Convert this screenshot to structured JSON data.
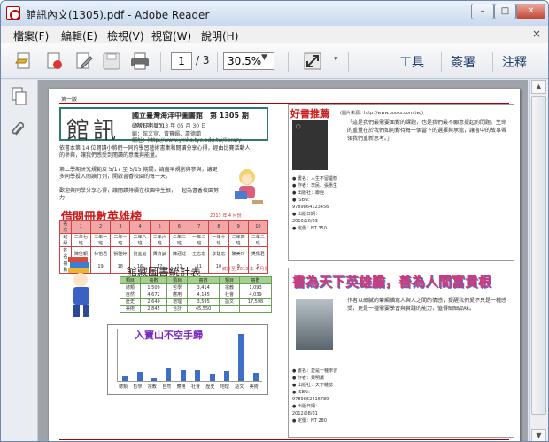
{
  "window": {
    "title": "館訊內文(1305).pdf - Adobe Reader",
    "controls": {
      "min": "–",
      "max": "□",
      "close": "✕"
    }
  },
  "menu": [
    "檔案(F)",
    "編輯(E)",
    "檢視(V)",
    "視窗(W)",
    "說明(H)"
  ],
  "menu_close": "×",
  "toolbar": {
    "page_current": "1",
    "page_total": "/ 3",
    "zoom": "30.5%",
    "tools_label": "工具",
    "sign_label": "簽署",
    "comment_label": "注釋"
  },
  "doc": {
    "header_tag": "第一版",
    "logo": "館訊",
    "library_name": "國立臺灣海洋中圖書館",
    "issue": "第 1305 期",
    "issue_year": "(2009.10 創刊)",
    "publish_date": "出版日期 2013 年 05 月 30 日",
    "editor": "編：館文宣、黃寶媚、蕭德蘭",
    "url": "網址：http://www.ymhs.tyc.edu.tw/library",
    "para1": "依書本第 14 位閱讀小將們一同的學習藝術書集和閱讀分享心得，經由比賽活動人的參與，讓我們感受到閱讀的意義與能量。",
    "para2": "第二學期研究規範及 5/17 至 5/15 期間，請盡早規劃與參與，讓更多同學投入閱讀行列，開啟書香校園的每一天。",
    "para3": "歡迎與同學分享心得，讓閱讀持續在校園中生根，一起為書香校園努力！",
    "section1_title": "借閱冊數英雄榜",
    "table1_caption": "2013 年 4 月份",
    "table1": [
      [
        "名次",
        "1",
        "2",
        "3",
        "4",
        "5",
        "6",
        "7",
        "8",
        "9",
        "10"
      ],
      [
        "班級",
        "二年七班",
        "三年一班",
        "二年一班",
        "二年八班",
        "三年六班",
        "二年三班",
        "一年二班",
        "一年十班",
        "二年四班",
        "三年二班"
      ],
      [
        "姓名",
        "陳佳穎",
        "林怡君",
        "張雅婷",
        "劉宜庭",
        "黃育誠",
        "陳冠廷",
        "王志宏",
        "李建宏",
        "陳美玲",
        "吳佩君"
      ],
      [
        "冊數",
        "27",
        "19",
        "18",
        "16",
        "12",
        "11",
        "11",
        "10",
        "9",
        "9"
      ]
    ],
    "section2_title": "館藏圖書統計表",
    "table2_caption": "統計至 2013 年 4 月份",
    "table2": [
      [
        "類目",
        "冊數",
        "類目",
        "冊數",
        "類目",
        "冊數"
      ],
      [
        "總類",
        "1,509",
        "哲學",
        "3,414",
        "宗教",
        "1,093"
      ],
      [
        "自然",
        "4,672",
        "應用",
        "4,145",
        "社會",
        "4,039"
      ],
      [
        "歷史",
        "2,640",
        "地理",
        "3,595",
        "語文",
        "17,598"
      ],
      [
        "美術",
        "2,845",
        "合計",
        "45,550",
        "",
        ""
      ]
    ],
    "chart_title": "入寶山不空手歸",
    "book_section_title": "好書推薦",
    "book_source": "(圖片來源：http://www.books.com.tw/)",
    "book1_meta": [
      "書名：人生不留遺憾",
      "作者：李民、張惠生",
      "出版社：聯經",
      "ISBN：9789864123456",
      "出版日期：2010/10/03",
      "定價：NT 350"
    ],
    "book1_text": "「這是我們最需要面對的課題，也是我們最不願意提起的問題。生命的重量在於我們如何對待每一個當下的選擇與承擔，讓書中的故事帶領我們重新思考。」",
    "slogan": "書為天下英雄膽，善為人間富貴根",
    "book2_meta": [
      "書名：愛是一種學習",
      "作者：黃明讓",
      "出版社：天下雜誌",
      "ISBN：9789862416789",
      "出版日期：2012/08/01",
      "定價：NT 280"
    ],
    "book2_text": "作者以細膩的筆觸描寫人與人之間的情感，提醒我們愛不只是一種感受，更是一種需要學習與實踐的能力，值得細細品味。"
  },
  "chart_data": {
    "type": "bar",
    "title": "入寶山不空手歸",
    "categories": [
      "總類",
      "哲學",
      "宗教",
      "自然",
      "應用",
      "社會",
      "歷史",
      "地理",
      "語文",
      "美術"
    ],
    "values": [
      1509,
      3414,
      1093,
      4672,
      4145,
      4039,
      2640,
      3595,
      17598,
      2845
    ],
    "ylim": [
      0,
      20000
    ]
  }
}
